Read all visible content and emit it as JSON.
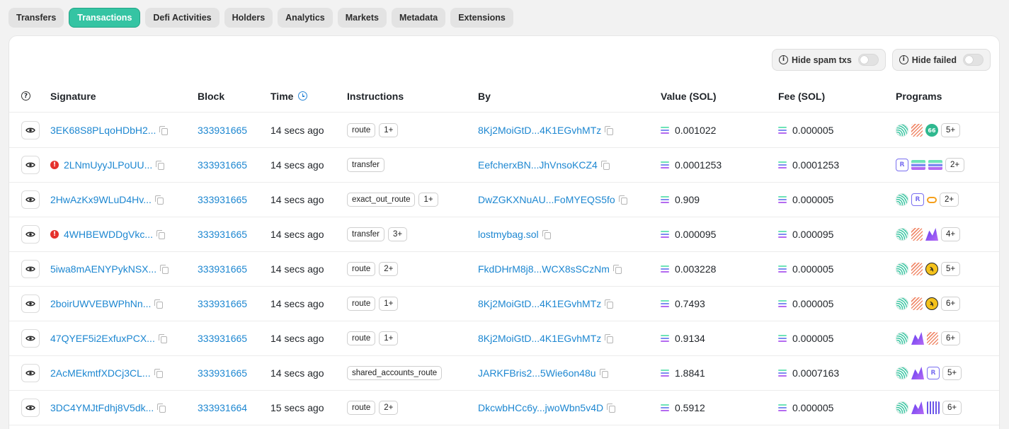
{
  "tabs": [
    "Transfers",
    "Transactions",
    "Defi Activities",
    "Holders",
    "Analytics",
    "Markets",
    "Metadata",
    "Extensions"
  ],
  "active_tab": "Transactions",
  "filters": {
    "hide_spam": "Hide spam txs",
    "hide_failed": "Hide failed"
  },
  "columns": {
    "help": "?",
    "signature": "Signature",
    "block": "Block",
    "time": "Time",
    "instructions": "Instructions",
    "by": "By",
    "value": "Value (SOL)",
    "fee": "Fee (SOL)",
    "programs": "Programs"
  },
  "rows": [
    {
      "failed": false,
      "signature": "3EK68S8PLqoHDbH2...",
      "block": "333931665",
      "time": "14 secs ago",
      "instr": "route",
      "instr_more": "1+",
      "by": "8Kj2MoiGtD...4K1EGvhMTz",
      "value": "0.001022",
      "fee": "0.000005",
      "programs": [
        "jupiter",
        "hatch",
        "66"
      ],
      "prog_more": "5+"
    },
    {
      "failed": true,
      "signature": "2LNmUyyJLPoUU...",
      "block": "333931665",
      "time": "14 secs ago",
      "instr": "transfer",
      "instr_more": "",
      "by": "EefcherxBN...JhVnsoKCZ4",
      "value": "0.0001253",
      "fee": "0.0001253",
      "programs": [
        "raydium",
        "solstack",
        "solstack"
      ],
      "prog_more": "2+"
    },
    {
      "failed": false,
      "signature": "2HwAzKx9WLuD4Hv...",
      "block": "333931665",
      "time": "14 secs ago",
      "instr": "exact_out_route",
      "instr_more": "1+",
      "by": "DwZGKXNuAU...FoMYEQS5fo",
      "value": "0.909",
      "fee": "0.000005",
      "programs": [
        "jupiter",
        "raydium",
        "orange"
      ],
      "prog_more": "2+"
    },
    {
      "failed": true,
      "signature": "4WHBEWDDgVkc...",
      "block": "333931665",
      "time": "14 secs ago",
      "instr": "transfer",
      "instr_more": "3+",
      "by": "lostmybag.sol",
      "value": "0.000095",
      "fee": "0.000095",
      "programs": [
        "jupiter",
        "hatch",
        "meteora"
      ],
      "prog_more": "4+"
    },
    {
      "failed": false,
      "signature": "5iwa8mAENYPykNSX...",
      "block": "333931665",
      "time": "14 secs ago",
      "instr": "route",
      "instr_more": "2+",
      "by": "FkdDHrM8j8...WCX8sSCzNm",
      "value": "0.003228",
      "fee": "0.000005",
      "programs": [
        "jupiter",
        "hatch",
        "yellow"
      ],
      "prog_more": "5+"
    },
    {
      "failed": false,
      "signature": "2boirUWVEBWPhNn...",
      "block": "333931665",
      "time": "14 secs ago",
      "instr": "route",
      "instr_more": "1+",
      "by": "8Kj2MoiGtD...4K1EGvhMTz",
      "value": "0.7493",
      "fee": "0.000005",
      "programs": [
        "jupiter",
        "hatch",
        "yellow"
      ],
      "prog_more": "6+"
    },
    {
      "failed": false,
      "signature": "47QYEF5i2ExfuxPCX...",
      "block": "333931665",
      "time": "14 secs ago",
      "instr": "route",
      "instr_more": "1+",
      "by": "8Kj2MoiGtD...4K1EGvhMTz",
      "value": "0.9134",
      "fee": "0.000005",
      "programs": [
        "jupiter",
        "meteora",
        "hatch"
      ],
      "prog_more": "6+"
    },
    {
      "failed": false,
      "signature": "2AcMEkmtfXDCj3CL...",
      "block": "333931665",
      "time": "14 secs ago",
      "instr": "shared_accounts_route",
      "instr_more": "",
      "by": "JARKFBris2...5Wie6on48u",
      "value": "1.8841",
      "fee": "0.0007163",
      "programs": [
        "jupiter",
        "meteora",
        "raydium"
      ],
      "prog_more": "5+"
    },
    {
      "failed": false,
      "signature": "3DC4YMJtFdhj8V5dk...",
      "block": "333931664",
      "time": "15 secs ago",
      "instr": "route",
      "instr_more": "2+",
      "by": "DkcwbHCc6y...jwoWbn5v4D",
      "value": "0.5912",
      "fee": "0.000005",
      "programs": [
        "jupiter",
        "meteora",
        "bars"
      ],
      "prog_more": "6+"
    }
  ]
}
